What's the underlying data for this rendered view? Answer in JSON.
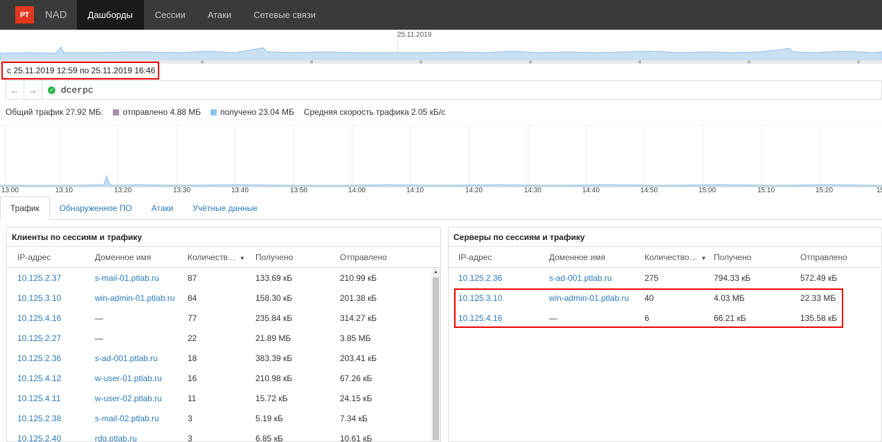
{
  "app": {
    "logo": "PT",
    "name": "NAD"
  },
  "nav": [
    {
      "label": "Дашборды"
    },
    {
      "label": "Сессии"
    },
    {
      "label": "Атаки"
    },
    {
      "label": "Сетевые связи"
    }
  ],
  "timeline": {
    "date": "25.11.2019"
  },
  "daterange": {
    "text": "с 25.11.2019 12:59 по 25.11.2019 16:46"
  },
  "filter": {
    "query": "dcerpc"
  },
  "stats": {
    "total": "Общий трафик 27.92 МБ:",
    "sent": "отправлено 4.88 МБ",
    "received": "получено 23.04 МБ",
    "avg_speed": "Средняя скорость трафика 2.05 кБ/с",
    "sent_color": "#a88fb0",
    "received_color": "#8fc4ec"
  },
  "traffic_axis": [
    "13:00",
    "13:10",
    "13:20",
    "13:30",
    "13:40",
    "13:50",
    "14:00",
    "14:10",
    "14:20",
    "14:30",
    "14:40",
    "14:50",
    "15:00",
    "15:10",
    "15:20",
    "15"
  ],
  "tabs": [
    {
      "label": "Трафик"
    },
    {
      "label": "Обнаруженное ПО"
    },
    {
      "label": "Атаки"
    },
    {
      "label": "Учётные данные"
    }
  ],
  "clients": {
    "title": "Клиенты по сессиям и трафику",
    "headers": [
      "IP-адрес",
      "Доменное имя",
      "Количеств…",
      "Получено",
      "Отправлено"
    ],
    "rows": [
      [
        "10.125.2.37",
        "s-mail-01.ptlab.ru",
        "87",
        "133.69 кБ",
        "210.99 кБ"
      ],
      [
        "10.125.3.10",
        "win-admin-01.ptlab.ru",
        "84",
        "158.30 кБ",
        "201.38 кБ"
      ],
      [
        "10.125.4.16",
        "—",
        "77",
        "235.84 кБ",
        "314.27 кБ"
      ],
      [
        "10.125.2.27",
        "—",
        "22",
        "21.89 МБ",
        "3.85 МБ"
      ],
      [
        "10.125.2.36",
        "s-ad-001.ptlab.ru",
        "18",
        "383.39 кБ",
        "203.41 кБ"
      ],
      [
        "10.125.4.12",
        "w-user-01.ptlab.ru",
        "16",
        "210.98 кБ",
        "67.26 кБ"
      ],
      [
        "10.125.4.11",
        "w-user-02.ptlab.ru",
        "11",
        "15.72 кБ",
        "24.15 кБ"
      ],
      [
        "10.125.2.38",
        "s-mail-02.ptlab.ru",
        "3",
        "5.19 кБ",
        "7.34 кБ"
      ],
      [
        "10.125.2.40",
        "rdg.ptlab.ru",
        "3",
        "6.85 кБ",
        "10.61 кБ"
      ]
    ]
  },
  "servers": {
    "title": "Серверы по сессиям и трафику",
    "headers": [
      "IP-адрес",
      "Доменное имя",
      "Количество…",
      "Получено",
      "Отправлено"
    ],
    "rows": [
      [
        "10.125.2.36",
        "s-ad-001.ptlab.ru",
        "275",
        "794.33 кБ",
        "572.49 кБ"
      ],
      [
        "10.125.3.10",
        "win-admin-01.ptlab.ru",
        "40",
        "4.03 МБ",
        "22.33 МБ"
      ],
      [
        "10.125.4.16",
        "—",
        "6",
        "66.21 кБ",
        "135.58 кБ"
      ]
    ]
  }
}
